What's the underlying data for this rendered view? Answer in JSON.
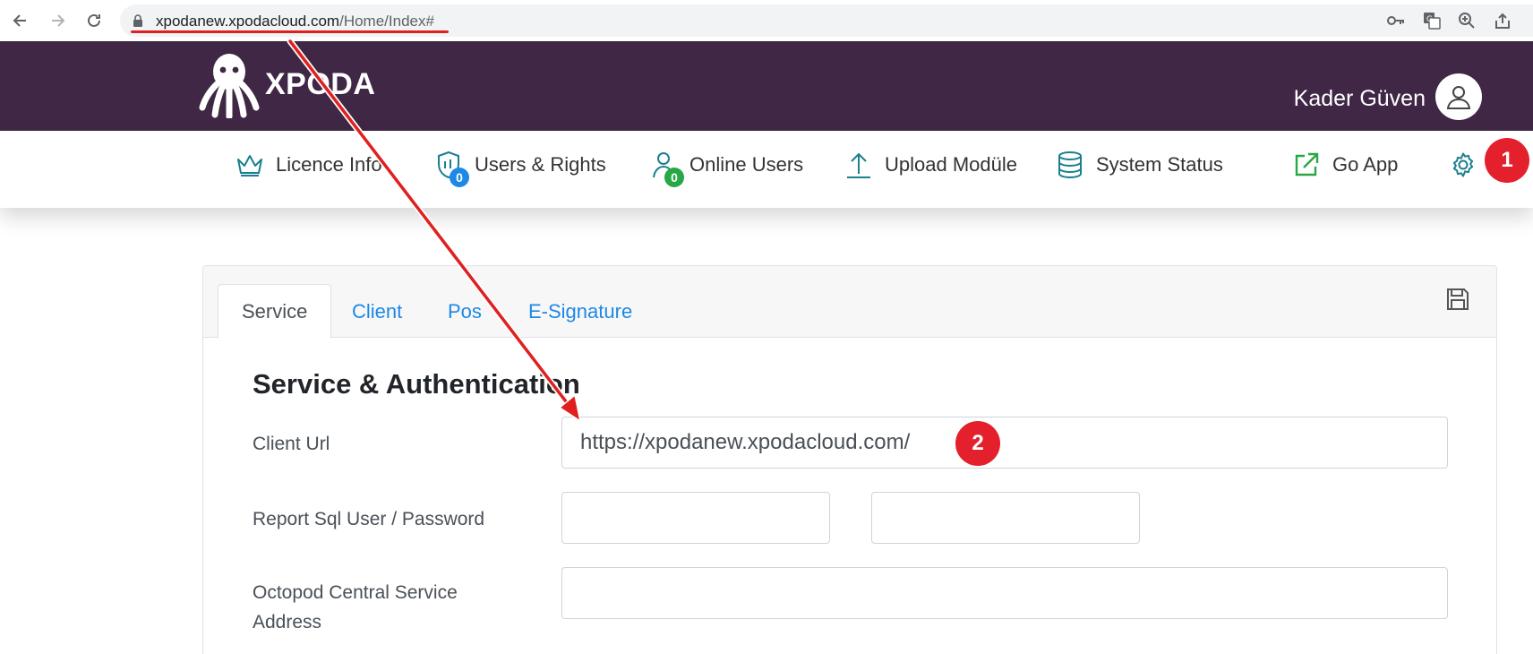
{
  "browser": {
    "url_host": "xpodanew.xpodacloud.com",
    "url_path": "/Home/Index#"
  },
  "header": {
    "logo_text": "XPODA",
    "user_name": "Kader Güven"
  },
  "menu": {
    "items": [
      {
        "label": "Licence Info",
        "icon": "crown-icon"
      },
      {
        "label": "Users & Rights",
        "icon": "shield-users-icon",
        "badge": "0"
      },
      {
        "label": "Online Users",
        "icon": "user-icon",
        "badge": "0"
      },
      {
        "label": "Upload Modüle",
        "icon": "upload-arrow-icon"
      },
      {
        "label": "System Status",
        "icon": "database-icon"
      },
      {
        "label": "Go App",
        "icon": "external-link-icon"
      }
    ]
  },
  "callouts": {
    "one": "1",
    "two": "2"
  },
  "tabs": [
    "Service",
    "Client",
    "Pos",
    "E-Signature"
  ],
  "form": {
    "section_title": "Service & Authentication",
    "client_url_label": "Client Url",
    "client_url_value": "https://xpodanew.xpodacloud.com/",
    "report_sql_label": "Report Sql User / Password",
    "octopod_label": "Octopod Central Service Address"
  },
  "colors": {
    "header_bg": "#3f2745",
    "accent_teal": "#1a7f8e",
    "link_blue": "#1e88e5",
    "badge_blue": "#1e88e5",
    "badge_green": "#28a745",
    "callout_red": "#e3202b"
  }
}
